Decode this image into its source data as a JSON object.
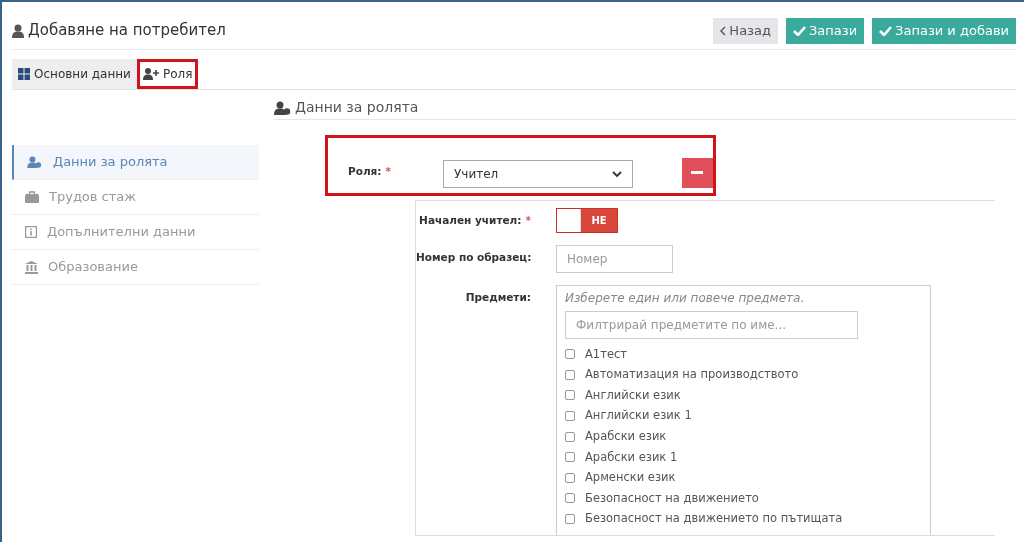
{
  "page_title": "Добавяне на потребител",
  "buttons": [
    {
      "kind": "back",
      "label": "Назад"
    },
    {
      "kind": "save",
      "label": "Запази"
    },
    {
      "kind": "save",
      "label": "Запази и добави"
    }
  ],
  "tabs": [
    {
      "kind": "grid",
      "label": "Основни данни",
      "selected": false,
      "highlighted": false
    },
    {
      "kind": "user-plus",
      "label": "Роля",
      "selected": true,
      "highlighted": true
    }
  ],
  "sidebar": {
    "items": [
      {
        "kind": "users",
        "label": "Данни за ролята",
        "selected": true
      },
      {
        "kind": "briefcase",
        "label": "Трудов стаж",
        "selected": false
      },
      {
        "kind": "info",
        "label": "Допълнителни данни",
        "selected": false
      },
      {
        "kind": "bank",
        "label": "Образование",
        "selected": false
      }
    ]
  },
  "section_title": "Данни за ролята",
  "role": {
    "label": "Роля:",
    "required_mark": "*",
    "value": "Учител",
    "highlighted": true
  },
  "primary_teacher": {
    "label": "Начален учител:",
    "required_mark": "*",
    "on": false,
    "state_text": "НЕ"
  },
  "sample_number": {
    "label": "Номер по образец:",
    "placeholder": "Номер"
  },
  "subjects": {
    "label": "Предмети:",
    "hint": "Изберете един или повече предмета.",
    "filter_placeholder": "Филтрирай предметите по име...",
    "items": [
      {
        "label": "А1тест",
        "checked": false
      },
      {
        "label": "Автоматизация на производството",
        "checked": false
      },
      {
        "label": "Английски език",
        "checked": false
      },
      {
        "label": "Английски език 1",
        "checked": false
      },
      {
        "label": "Арабски език",
        "checked": false
      },
      {
        "label": "Арабски език 1",
        "checked": false
      },
      {
        "label": "Арменски език",
        "checked": false
      },
      {
        "label": "Безопасност на движението",
        "checked": false
      },
      {
        "label": "Безопасност на движението по пътищата",
        "checked": false
      }
    ]
  }
}
